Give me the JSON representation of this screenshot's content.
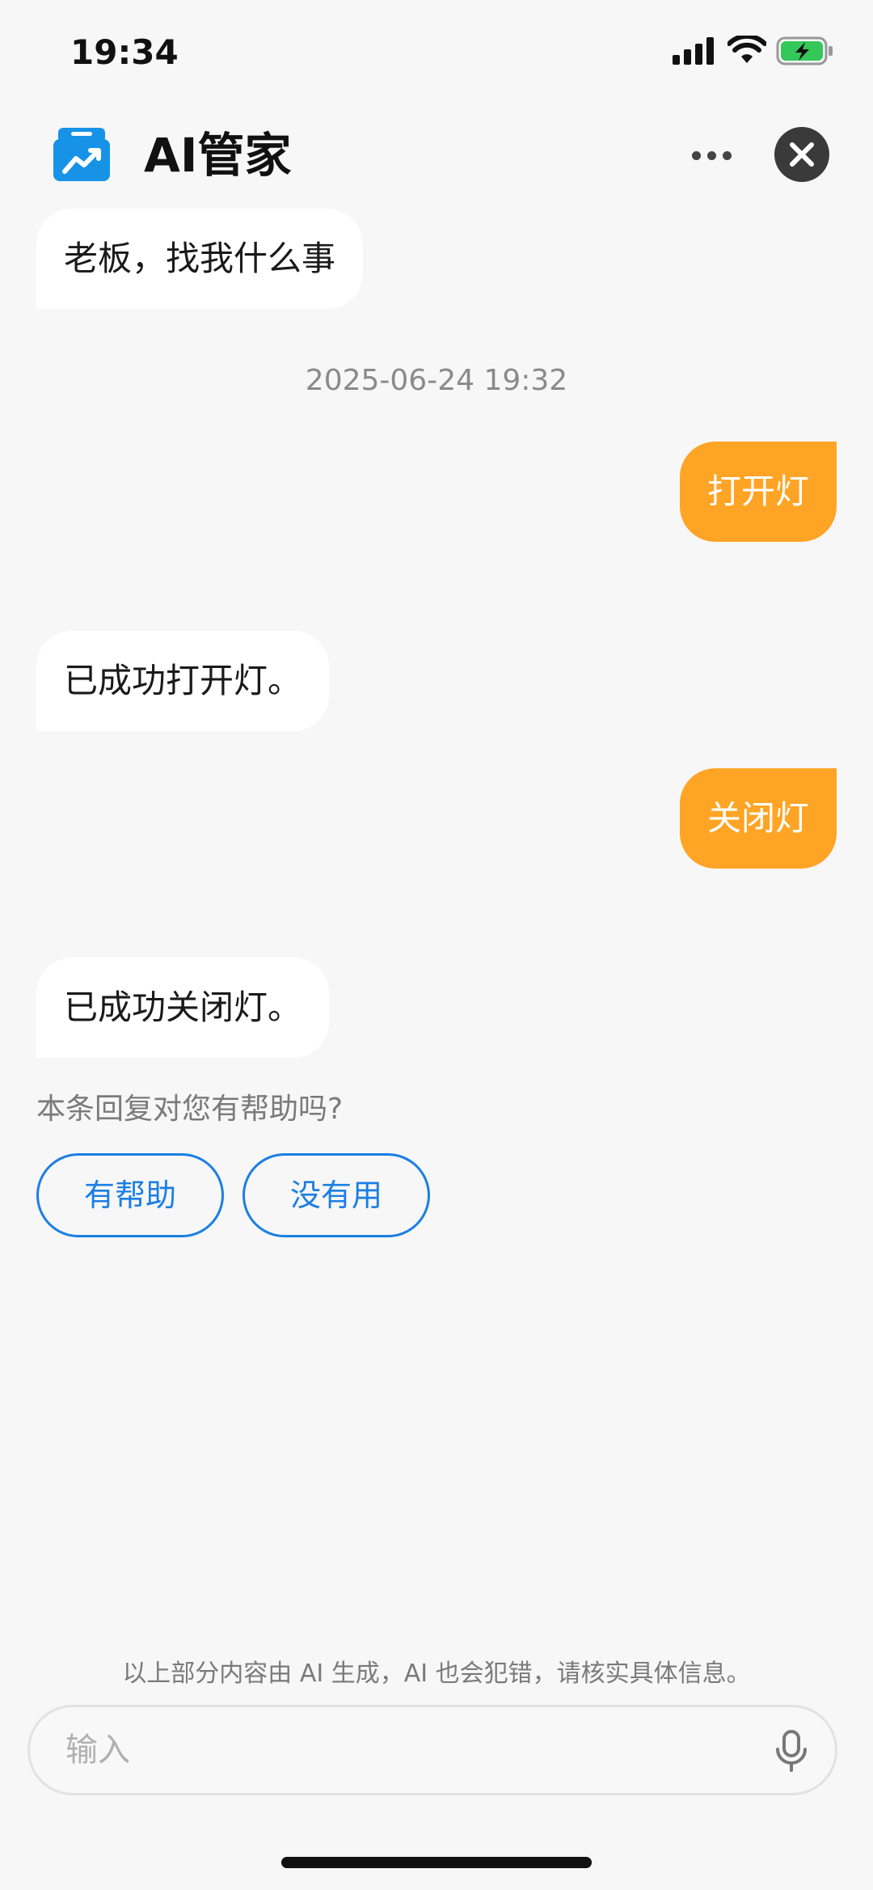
{
  "status_bar": {
    "time": "19:34",
    "icons": [
      "signal-icon",
      "wifi-icon",
      "battery-charging-icon"
    ]
  },
  "header": {
    "title": "AI管家",
    "logo_icon": "box-chart-logo-icon",
    "more_icon": "more-dots-icon",
    "close_icon": "close-icon"
  },
  "chat": {
    "greeting": "老板，找我什么事",
    "timestamp": "2025-06-24 19:32",
    "messages": [
      {
        "role": "user",
        "text": "打开灯"
      },
      {
        "role": "ai",
        "text": "已成功打开灯。"
      },
      {
        "role": "user",
        "text": "关闭灯"
      },
      {
        "role": "ai",
        "text": "已成功关闭灯。"
      }
    ],
    "feedback": {
      "question": "本条回复对您有帮助吗?",
      "helpful_label": "有帮助",
      "unhelpful_label": "没有用"
    }
  },
  "footer": {
    "disclaimer": "以上部分内容由 AI 生成，AI 也会犯错，请核实具体信息。",
    "input_placeholder": "输入",
    "mic_icon": "microphone-icon"
  },
  "colors": {
    "user_bubble": "#ffa424",
    "ai_bubble": "#ffffff",
    "accent_blue": "#1b7fe3",
    "background": "#f7f7f7"
  }
}
